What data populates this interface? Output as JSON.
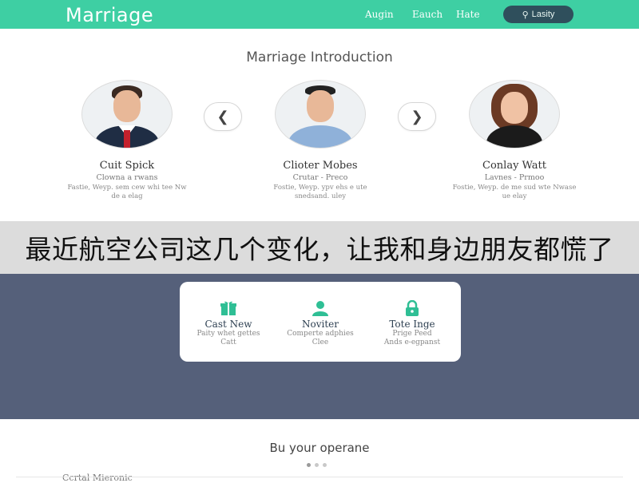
{
  "header": {
    "logo": "Marriage",
    "nav": [
      "Augin",
      "Eauch",
      "Hate"
    ],
    "search_label": "Lasity",
    "colors": {
      "bar": "#3ecfa3",
      "search_pill": "#2f4f5c"
    }
  },
  "intro": {
    "title": "Marriage Introduction",
    "prev_icon": "chevron-left-icon",
    "next_icon": "chevron-right-icon",
    "profiles": [
      {
        "name": "Cuit Spick",
        "subtitle": "Clowna a rwans",
        "desc": "Fastie, Weyp. sem cew whi tee Nw de a  elag"
      },
      {
        "name": "Clioter Mobes",
        "subtitle": "Crutar - Preco",
        "desc": "Fostie, Weyp. ypv ehs e ute snedsand. uley"
      },
      {
        "name": "Conlay Watt",
        "subtitle": "Lavnes - Prmoo",
        "desc": "Fostie, Weyp. de me sud wte Nwase  ue elay"
      }
    ]
  },
  "banner": {
    "text": "最近航空公司这几个变化，让我和身边朋友都慌了"
  },
  "features": [
    {
      "icon": "gift-icon",
      "title": "Cast New",
      "desc_line1": "Paity whet gettes",
      "desc_line2": "Catt"
    },
    {
      "icon": "user-icon",
      "title": "Noviter",
      "desc_line1": "Comperte adphies",
      "desc_line2": "Clee"
    },
    {
      "icon": "lock-icon",
      "title": "Tote Inge",
      "desc_line1": "Prige Peed",
      "desc_line2": "Ands e-egpanst"
    }
  ],
  "bottom": {
    "title": "Bu your operane",
    "partial_text": "Ccrtal Mieronic"
  }
}
